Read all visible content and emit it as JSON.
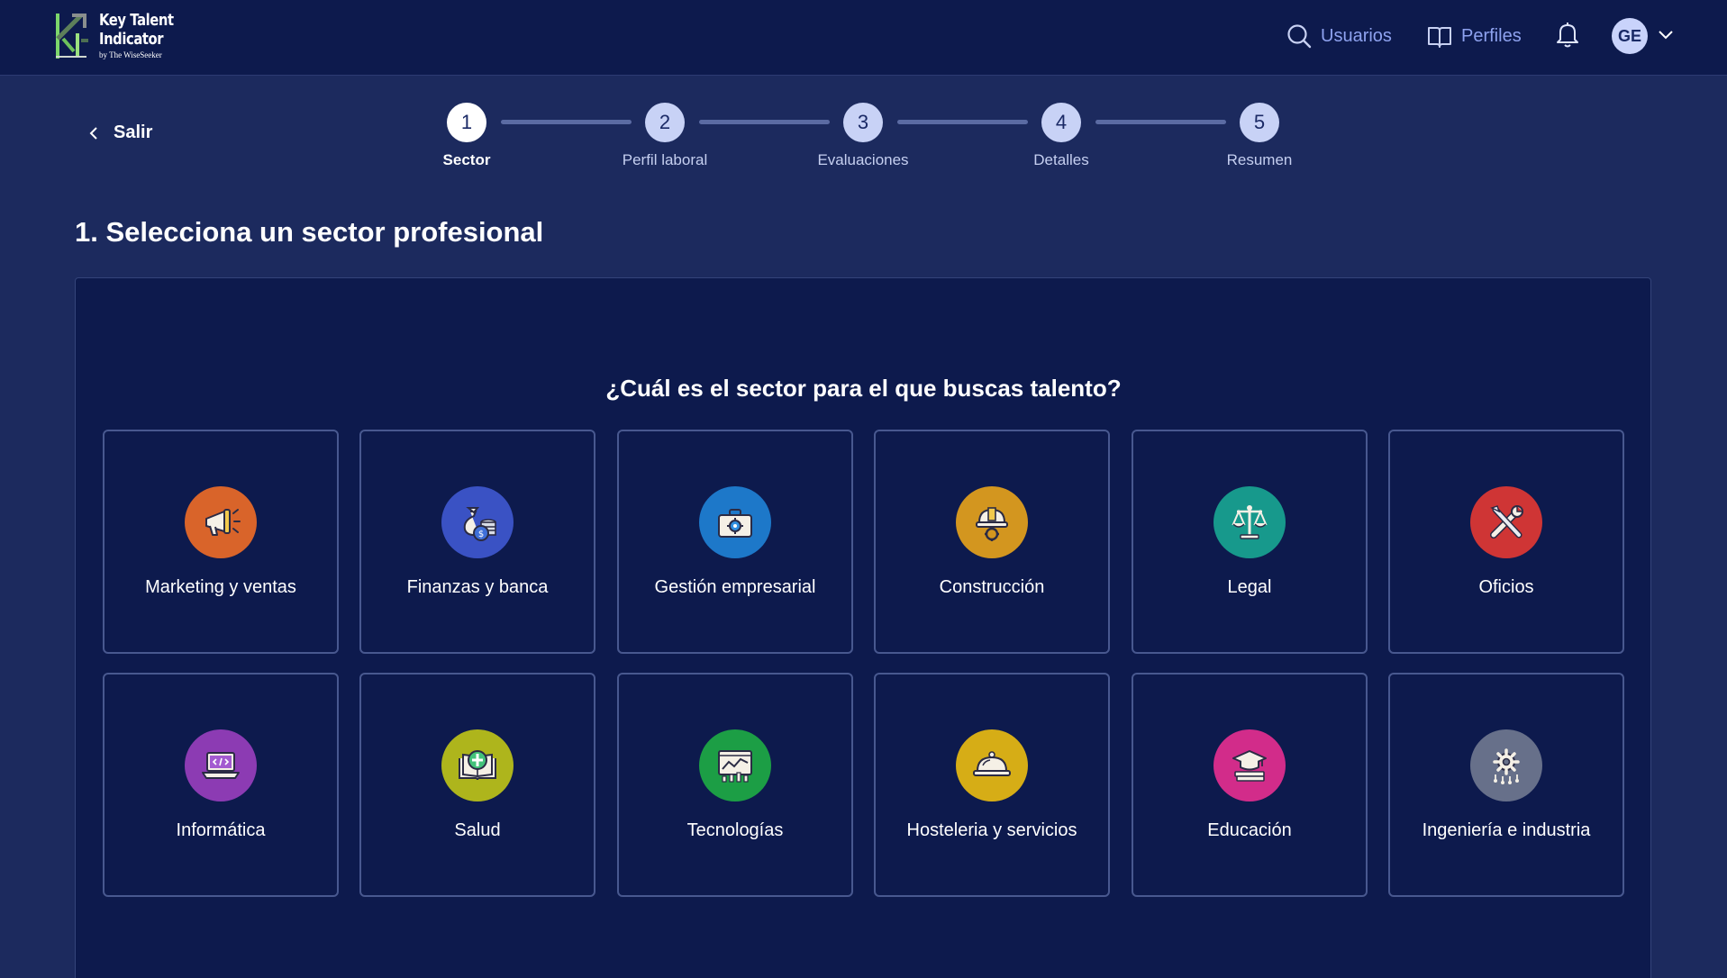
{
  "app": {
    "logo_line1": "Key Talent",
    "logo_line2": "Indicator",
    "logo_by": "by The WiseSeeker"
  },
  "nav": {
    "usuarios": "Usuarios",
    "perfiles": "Perfiles",
    "avatar_initials": "GE"
  },
  "back": {
    "label": "Salir"
  },
  "stepper": [
    {
      "num": "1",
      "label": "Sector",
      "active": true
    },
    {
      "num": "2",
      "label": "Perfil laboral",
      "active": false
    },
    {
      "num": "3",
      "label": "Evaluaciones",
      "active": false
    },
    {
      "num": "4",
      "label": "Detalles",
      "active": false
    },
    {
      "num": "5",
      "label": "Resumen",
      "active": false
    }
  ],
  "page_title": "1. Selecciona un sector profesional",
  "question": "¿Cuál es el sector para el que buscas talento?",
  "sectors": [
    {
      "label": "Marketing y ventas",
      "icon": "megaphone-icon",
      "color": "#d9642a"
    },
    {
      "label": "Finanzas y banca",
      "icon": "money-bag-icon",
      "color": "#3a52c4"
    },
    {
      "label": "Gestión empresarial",
      "icon": "briefcase-icon",
      "color": "#1d78c9"
    },
    {
      "label": "Construcción",
      "icon": "hard-hat-icon",
      "color": "#d3961f"
    },
    {
      "label": "Legal",
      "icon": "scales-icon",
      "color": "#17998c"
    },
    {
      "label": "Oficios",
      "icon": "tools-icon",
      "color": "#cf3535"
    },
    {
      "label": "Informática",
      "icon": "laptop-code-icon",
      "color": "#8c3bb3"
    },
    {
      "label": "Salud",
      "icon": "health-book-icon",
      "color": "#aeb51c"
    },
    {
      "label": "Tecnologías",
      "icon": "chart-screen-icon",
      "color": "#1c9e45"
    },
    {
      "label": "Hosteleria y servicios",
      "icon": "cloche-icon",
      "color": "#d6ad16"
    },
    {
      "label": "Educación",
      "icon": "graduation-icon",
      "color": "#d22c8a"
    },
    {
      "label": "Ingeniería e industria",
      "icon": "gear-circuit-icon",
      "color": "#67708a"
    }
  ]
}
